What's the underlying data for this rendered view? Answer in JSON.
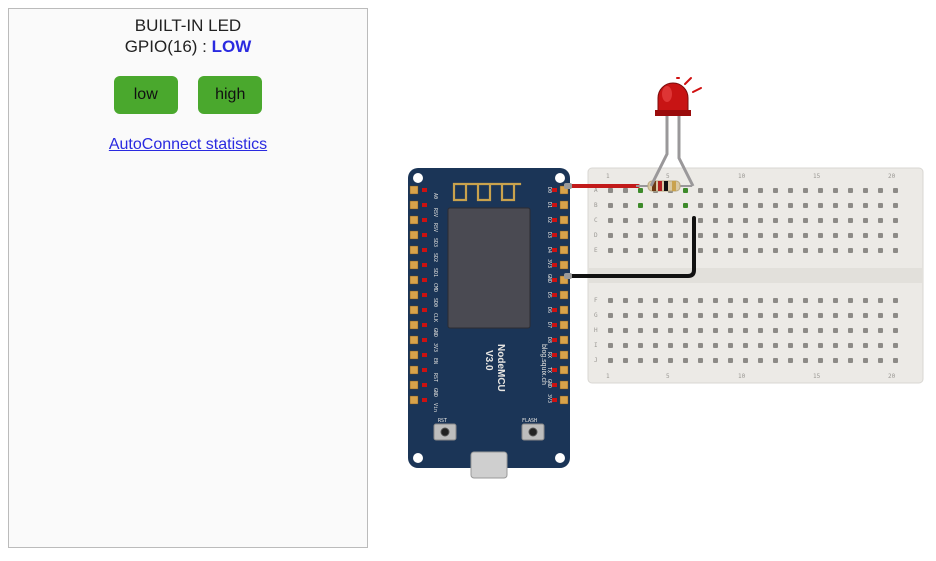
{
  "panel": {
    "title": "BUILT-IN LED",
    "gpio_prefix": "GPIO(",
    "gpio_num": "16",
    "gpio_suffix": ") : ",
    "state": "LOW",
    "btn_low": "low",
    "btn_high": "high",
    "link": "AutoConnect statistics"
  },
  "board": {
    "name": "NodeMCU",
    "version": "V3.0",
    "credit": "blog.squix.ch",
    "btn_left": "RST",
    "btn_right": "FLASH",
    "usb": "micro-usb",
    "left_pins": [
      "A0",
      "RSV",
      "RSV",
      "SD3",
      "SD2",
      "SD1",
      "CMD",
      "SD0",
      "CLK",
      "GND",
      "3V3",
      "EN",
      "RST",
      "GND",
      "Vin"
    ],
    "right_pins": [
      "D0",
      "D1",
      "D2",
      "D3",
      "D4",
      "3V3",
      "GND",
      "D5",
      "D6",
      "D7",
      "D8",
      "RX",
      "TX",
      "GND",
      "3V3"
    ]
  },
  "breadboard": {
    "rows": [
      "A",
      "B",
      "C",
      "D",
      "E",
      "F",
      "G",
      "H",
      "I",
      "J"
    ],
    "col_labels": [
      1,
      5,
      10,
      15,
      20
    ]
  },
  "d0_wire_color": "#c21a1a",
  "gnd_wire_color": "#111111",
  "led_on": true,
  "resistor_bands": [
    "brown",
    "red",
    "brown",
    "gold"
  ]
}
